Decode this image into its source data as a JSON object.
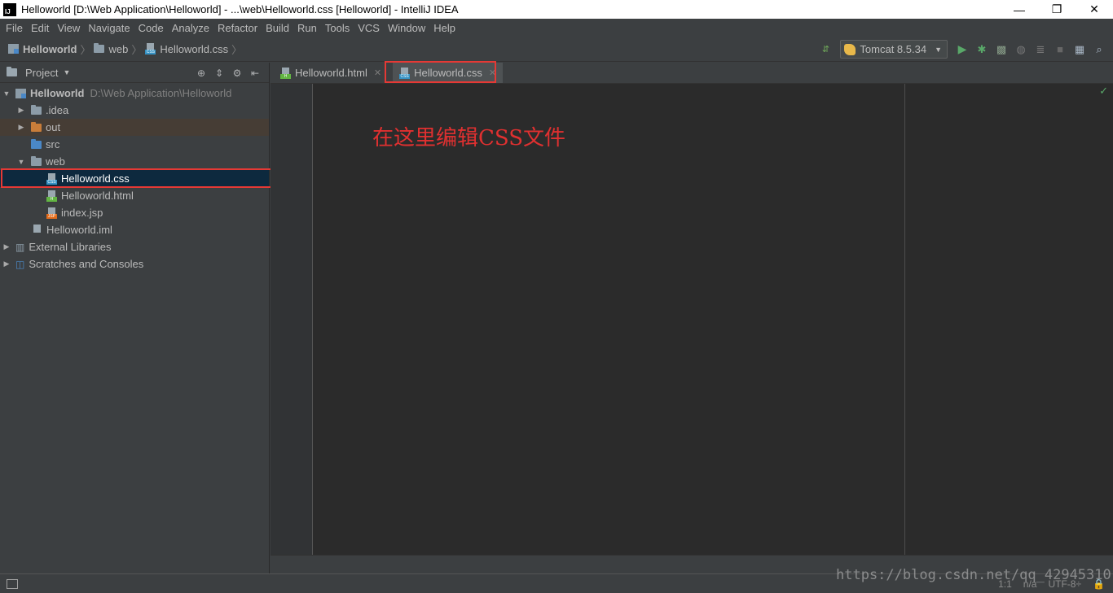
{
  "window": {
    "title": "Helloworld [D:\\Web Application\\Helloworld] - ...\\web\\Helloworld.css [Helloworld] - IntelliJ IDEA",
    "app_icon_text": "IJ",
    "minimize_glyph": "—",
    "restore_glyph": "❐",
    "close_glyph": "✕"
  },
  "menubar": {
    "items": [
      "File",
      "Edit",
      "View",
      "Navigate",
      "Code",
      "Analyze",
      "Refactor",
      "Build",
      "Run",
      "Tools",
      "VCS",
      "Window",
      "Help"
    ]
  },
  "breadcrumb": {
    "project": "Helloworld",
    "folder": "web",
    "file": "Helloworld.css"
  },
  "toolbar": {
    "run_config": "Tomcat 8.5.34",
    "icons": [
      "build-icon",
      "run-icon",
      "debug-icon",
      "coverage-icon",
      "profile-icon",
      "attach-icon",
      "stop-icon",
      "project-structure-icon",
      "search-icon"
    ]
  },
  "project_panel": {
    "title": "Project",
    "tree": [
      {
        "name": "Helloworld",
        "path": "D:\\Web Application\\Helloworld"
      },
      {
        "name": ".idea"
      },
      {
        "name": "out"
      },
      {
        "name": "src"
      },
      {
        "name": "web"
      },
      {
        "name": "Helloworld.css",
        "type_label": "CSS"
      },
      {
        "name": "Helloworld.html",
        "type_label": "H"
      },
      {
        "name": "index.jsp",
        "type_label": "JSP"
      },
      {
        "name": "Helloworld.iml"
      },
      {
        "name": "External Libraries"
      },
      {
        "name": "Scratches and Consoles"
      }
    ]
  },
  "editor": {
    "tabs": [
      {
        "label": "Helloworld.html",
        "type_label": "H"
      },
      {
        "label": "Helloworld.css",
        "type_label": "CSS"
      }
    ],
    "annotation": "在这里编辑CSS文件"
  },
  "statusbar": {
    "position": "1:1",
    "line_separator": "n/a",
    "encoding": "UTF-8÷"
  },
  "watermark": "https://blog.csdn.net/qq_42945310",
  "colors": {
    "highlight_border": "#e53935",
    "annotation": "#e03030",
    "selection": "#0d293e",
    "editor_bg": "#2b2b2b",
    "panel_bg": "#3c3f41"
  }
}
